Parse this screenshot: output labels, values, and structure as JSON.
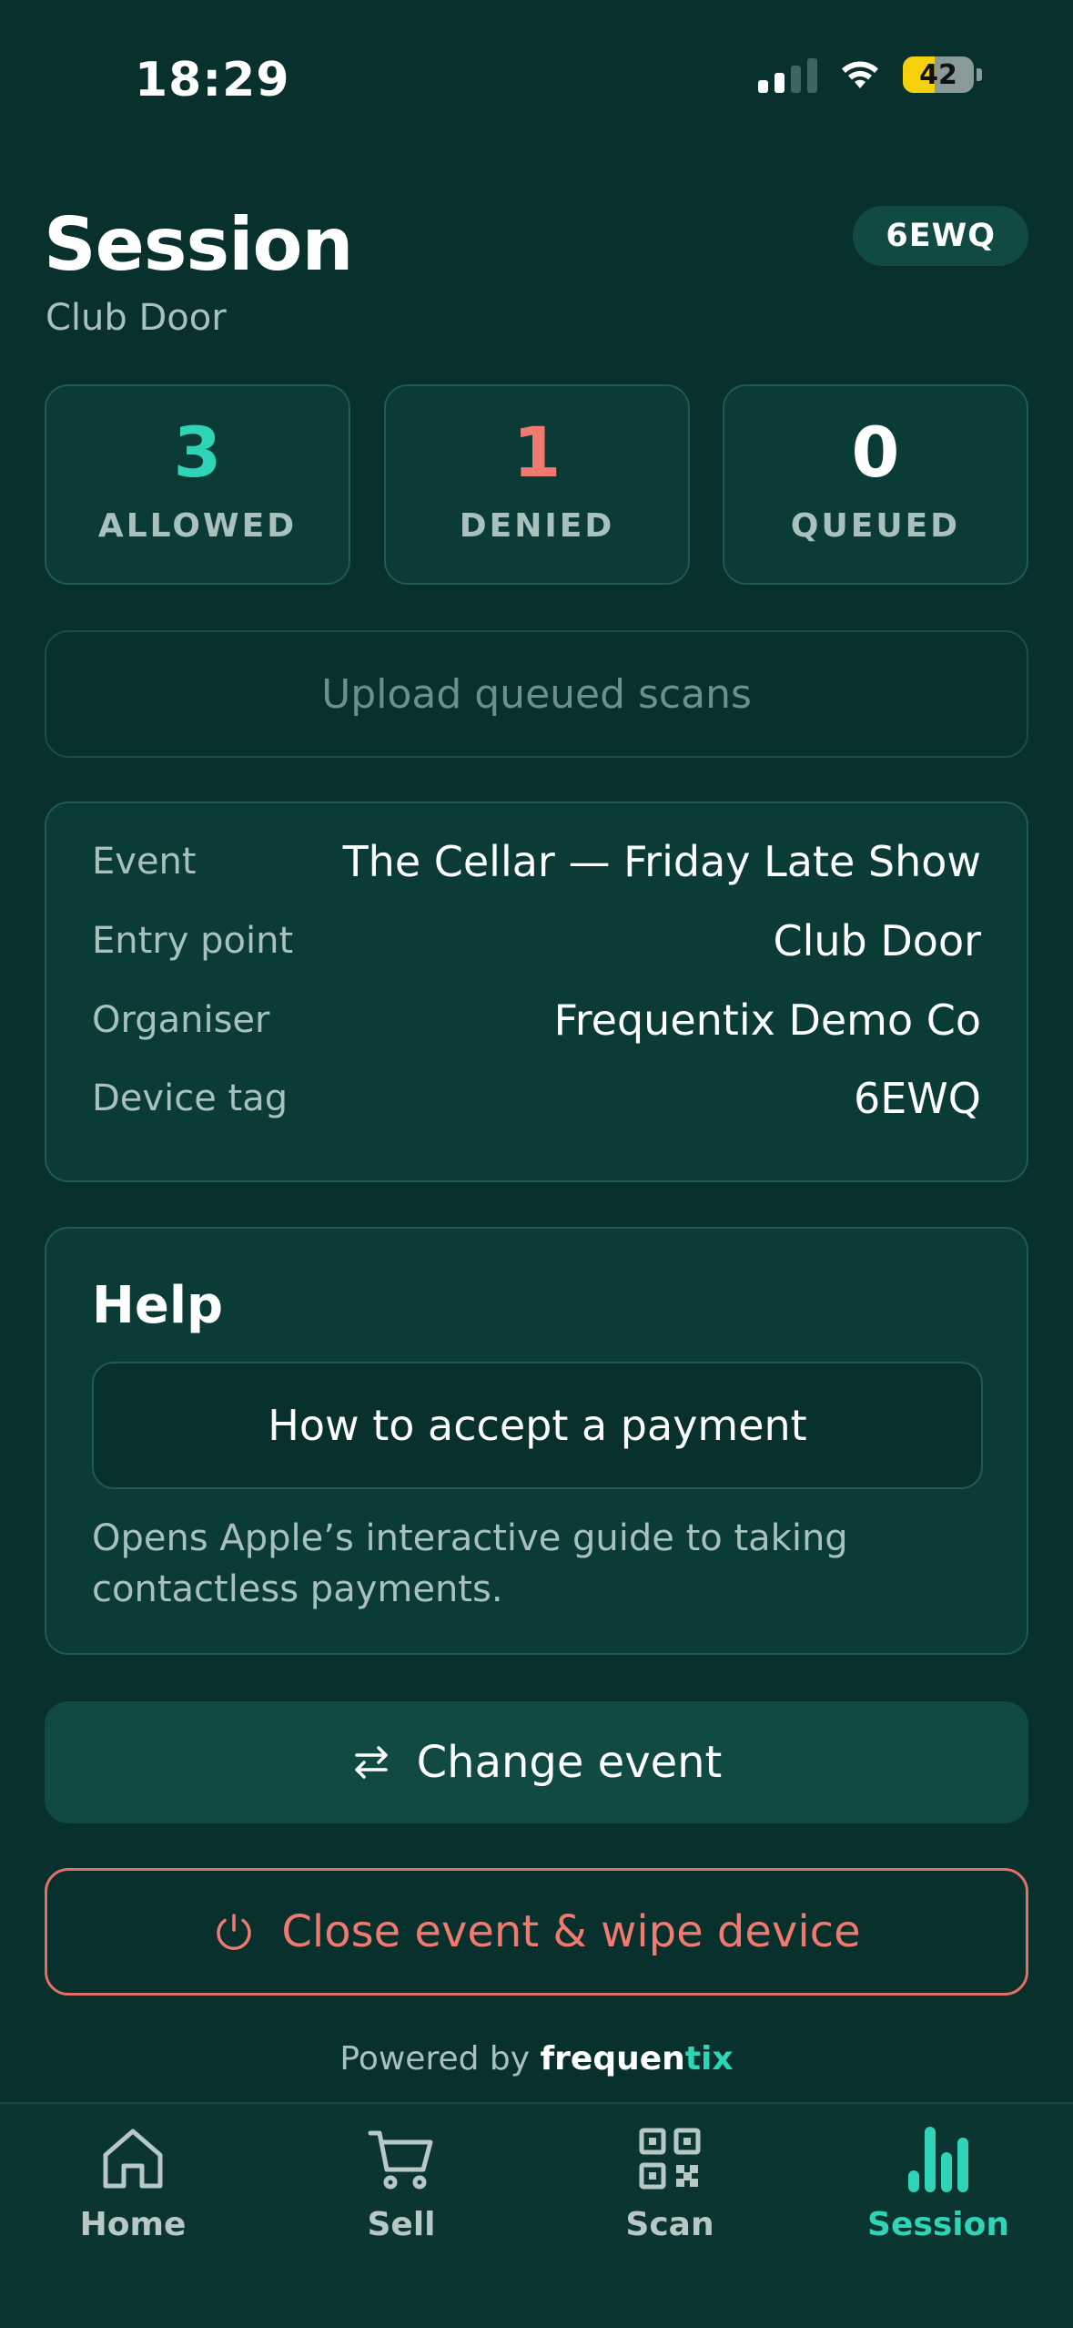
{
  "status_bar": {
    "time": "18:29",
    "battery": "42"
  },
  "header": {
    "title": "Session",
    "subtitle": "Club Door",
    "device_badge": "6EWQ"
  },
  "stats": [
    {
      "value": "3",
      "label": "ALLOWED",
      "color": "#2fd3b5"
    },
    {
      "value": "1",
      "label": "DENIED",
      "color": "#f07a70"
    },
    {
      "value": "0",
      "label": "QUEUED",
      "color": "#ffffff"
    }
  ],
  "upload_button": {
    "label": "Upload queued scans"
  },
  "info": {
    "rows": [
      {
        "label": "Event",
        "value": "The Cellar — Friday Late Show"
      },
      {
        "label": "Entry point",
        "value": "Club Door"
      },
      {
        "label": "Organiser",
        "value": "Frequentix Demo Co"
      },
      {
        "label": "Device tag",
        "value": "6EWQ"
      }
    ]
  },
  "help": {
    "title": "Help",
    "button_label": "How to accept a payment",
    "description": "Opens Apple’s interactive guide to taking contactless payments."
  },
  "actions": {
    "change_event": "Change event",
    "close_event": "Close event & wipe device"
  },
  "footer": {
    "powered_by": "Powered by",
    "brand_main": "frequen",
    "brand_accent": "tix"
  },
  "tabs": [
    {
      "label": "Home",
      "icon": "home-icon",
      "active": false
    },
    {
      "label": "Sell",
      "icon": "cart-icon",
      "active": false
    },
    {
      "label": "Scan",
      "icon": "qr-code-icon",
      "active": false
    },
    {
      "label": "Session",
      "icon": "bar-chart-icon",
      "active": true
    }
  ],
  "colors": {
    "background": "#08302c",
    "accent": "#2fd3b5",
    "danger": "#f07a70"
  }
}
